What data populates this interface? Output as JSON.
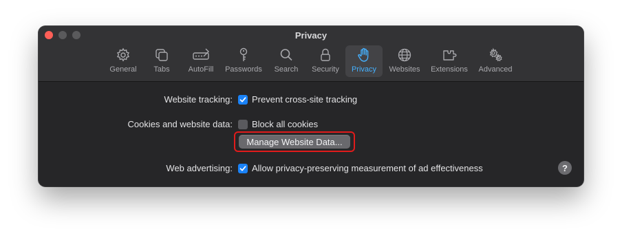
{
  "window": {
    "title": "Privacy"
  },
  "toolbar": {
    "tabs": [
      {
        "label": "General",
        "icon": "gear-icon"
      },
      {
        "label": "Tabs",
        "icon": "tabs-icon"
      },
      {
        "label": "AutoFill",
        "icon": "autofill-icon"
      },
      {
        "label": "Passwords",
        "icon": "key-icon"
      },
      {
        "label": "Search",
        "icon": "magnifier-icon"
      },
      {
        "label": "Security",
        "icon": "lock-icon"
      },
      {
        "label": "Privacy",
        "icon": "hand-icon",
        "active": true
      },
      {
        "label": "Websites",
        "icon": "globe-icon"
      },
      {
        "label": "Extensions",
        "icon": "puzzle-icon"
      },
      {
        "label": "Advanced",
        "icon": "gears-icon"
      }
    ]
  },
  "settings": {
    "tracking": {
      "label": "Website tracking:",
      "option": "Prevent cross-site tracking",
      "checked": true
    },
    "cookies": {
      "label": "Cookies and website data:",
      "option": "Block all cookies",
      "checked": false,
      "button": "Manage Website Data..."
    },
    "advertising": {
      "label": "Web advertising:",
      "option": "Allow privacy-preserving measurement of ad effectiveness",
      "checked": true
    }
  },
  "help": {
    "label": "?"
  },
  "colors": {
    "accent": "#1a82f7",
    "active_tab": "#45b1ff",
    "highlight": "#e11b1b",
    "window_bg": "#262628"
  }
}
